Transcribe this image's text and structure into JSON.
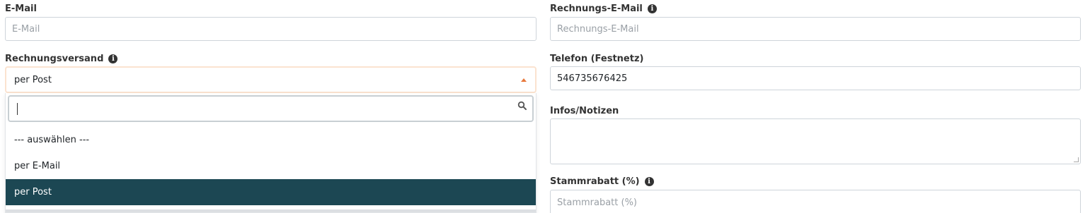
{
  "left": {
    "email": {
      "label": "E-Mail",
      "placeholder": "E-Mail",
      "value": ""
    },
    "rechnungsversand": {
      "label": "Rechnungsversand",
      "selected": "per Post",
      "search_value": "",
      "options": [
        "--- auswählen ---",
        "per E-Mail",
        "per Post"
      ],
      "selected_index": 2
    }
  },
  "right": {
    "rechnungs_email": {
      "label": "Rechnungs-E-Mail",
      "placeholder": "Rechnungs-E-Mail",
      "value": ""
    },
    "telefon": {
      "label": "Telefon (Festnetz)",
      "value": "546735676425"
    },
    "infos": {
      "label": "Infos/Notizen",
      "value": ""
    },
    "stammrabatt": {
      "label": "Stammrabatt (%)",
      "placeholder": "Stammrabatt (%)",
      "value": ""
    }
  },
  "icons": {
    "info": "info-icon",
    "search": "search-icon",
    "caret": "caret-up-icon"
  },
  "colors": {
    "selected_option_bg": "#1c4753",
    "caret": "#e8793c",
    "focus_border": "#fbe3d0"
  }
}
